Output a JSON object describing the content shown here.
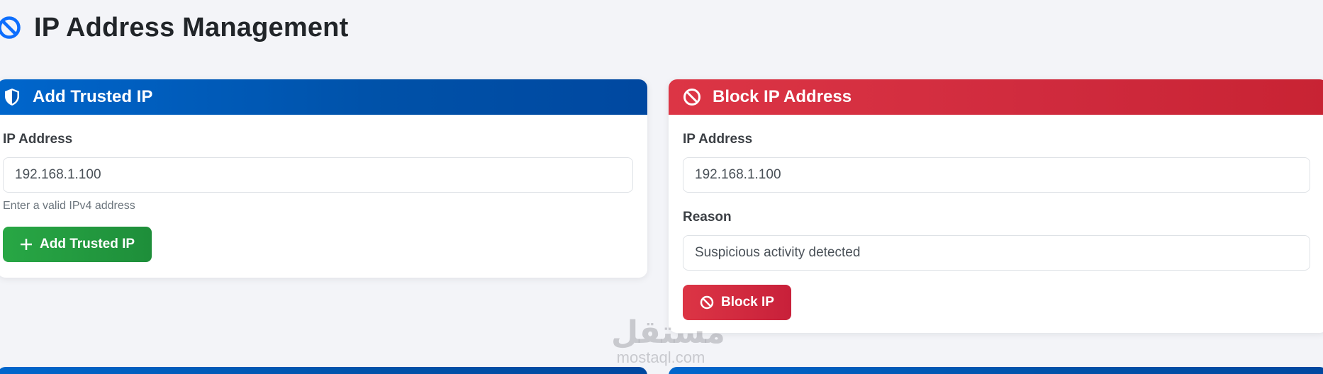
{
  "page": {
    "title": "IP Address Management",
    "title_icon": "ban-icon"
  },
  "trusted_card": {
    "title": "Add Trusted IP",
    "icon": "shield-icon",
    "ip_label": "IP Address",
    "ip_value": "192.168.1.100",
    "ip_help": "Enter a valid IPv4 address",
    "button_label": "Add Trusted IP",
    "button_icon": "plus-icon"
  },
  "block_card": {
    "title": "Block IP Address",
    "icon": "ban-icon",
    "ip_label": "IP Address",
    "ip_value": "192.168.1.100",
    "reason_label": "Reason",
    "reason_value": "Suspicious activity detected",
    "button_label": "Block IP",
    "button_icon": "ban-icon"
  },
  "watermark": {
    "logo": "مستقل",
    "text": "mostaql.com"
  },
  "colors": {
    "primary_blue": "#0058b8",
    "danger_red": "#dc3545",
    "success_green": "#28a745",
    "page_bg": "#f3f4f8"
  }
}
